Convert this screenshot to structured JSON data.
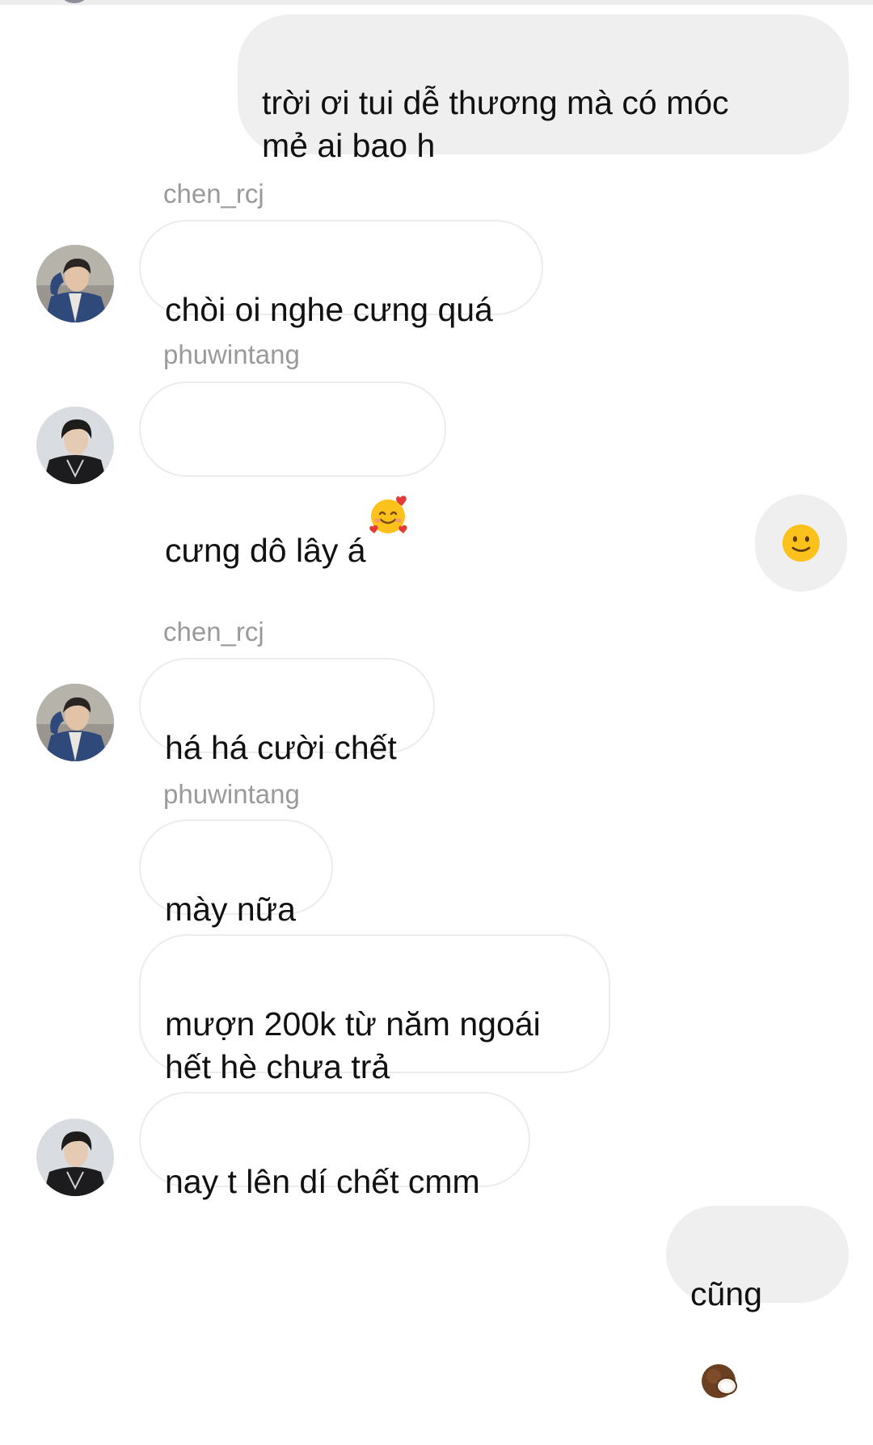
{
  "messages": [
    {
      "text": "trời ơi tui dễ thương mà có móc\nmẻ ai bao h"
    },
    {
      "sender": "chen_rcj",
      "text": "chòi oi nghe cưng quá"
    },
    {
      "sender": "phuwintang",
      "text": "cưng dô lây á",
      "emoji": "smiling-face-with-hearts-icon"
    },
    {
      "emoji": "slightly-smiling-face-icon"
    },
    {
      "sender": "chen_rcj",
      "text": "há há cười chết"
    },
    {
      "sender": "phuwintang",
      "text": "mày nữa"
    },
    {
      "text": "mượn 200k từ năm ngoái\nhết hè chưa trả"
    },
    {
      "text": "nay t lên dí chết cmm"
    },
    {
      "text": "cũng",
      "emoji": "coconut-icon"
    }
  ]
}
